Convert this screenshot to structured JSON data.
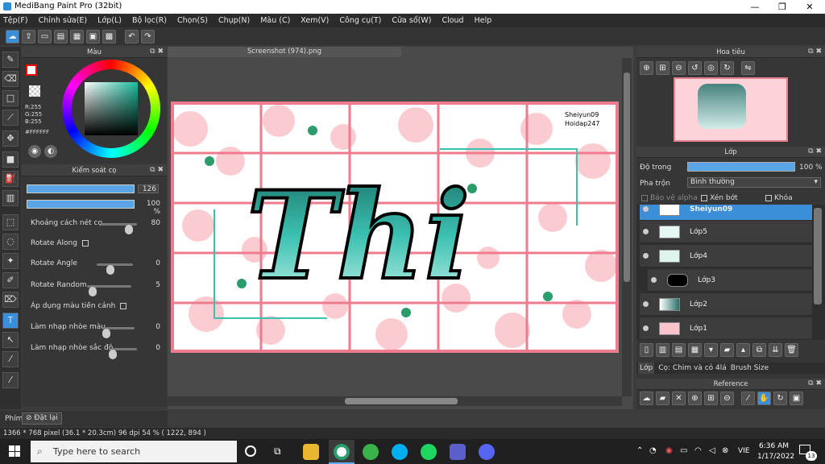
{
  "app": {
    "title": "MediBang Paint Pro (32bit)"
  },
  "window": {
    "minimize": "—",
    "maximize": "❐",
    "close": "✕"
  },
  "menu": [
    "Tệp(F)",
    "Chỉnh sửa(E)",
    "Lớp(L)",
    "Bộ lọc(R)",
    "Chọn(S)",
    "Chụp(N)",
    "Màu (C)",
    "Xem(V)",
    "Công cụ(T)",
    "Cửa sổ(W)",
    "Cloud",
    "Help"
  ],
  "color_panel": {
    "title": "Màu",
    "r": "R:255",
    "g": "G:255",
    "b": "B:255",
    "hex": "#FFFFFF",
    "accent": "#ff0000"
  },
  "brush_panel": {
    "title": "Kiểm soát cọ",
    "size": "126",
    "opacity": "100 %",
    "rows": [
      {
        "label": "Khoảng cách nét cọ",
        "value": "80",
        "level": 0.85
      },
      {
        "label": "Rotate Along",
        "checkbox": true
      },
      {
        "label": "Rotate Angle",
        "value": "0",
        "level": 0.35
      },
      {
        "label": "Rotate Random",
        "value": "5",
        "level": 0.05
      },
      {
        "label": "Áp dụng màu tiền cảnh",
        "checkbox": true
      },
      {
        "label": "Làm nhạp nhòe màu",
        "value": "0",
        "level": 0.0
      },
      {
        "label": "Làm nhạp nhòe sắc độ",
        "value": "0",
        "level": 0.0
      }
    ]
  },
  "document": {
    "tab": "Screenshot (974).png",
    "watermark_line1": "Sheiyun09",
    "watermark_line2": "Hoidap247",
    "art_text": "Thi",
    "art_accent": "#3bc1b1"
  },
  "navigator": {
    "title": "Hoa tiêu"
  },
  "layers": {
    "title": "Lớp",
    "opacity_label": "Độ trong",
    "opacity_value": "100 %",
    "blend_label": "Pha trộn",
    "blend_value": "Bình thường",
    "protect_alpha": "Bảo vệ alpha",
    "clipping": "Xén bớt",
    "lock": "Khóa",
    "items": [
      {
        "name": "Sheiyun09",
        "selected": true
      },
      {
        "name": "Lớp5"
      },
      {
        "name": "Lớp4"
      },
      {
        "name": "Lớp3"
      },
      {
        "name": "Lớp2"
      },
      {
        "name": "Lớp1"
      }
    ],
    "tab1": "Lớp",
    "tab2": "Cọ: Chim và cỏ 4lá",
    "tab3": "Brush Size"
  },
  "reference": {
    "title": "Reference"
  },
  "bottom": {
    "tab": "Phím",
    "reset": "Đặt lại"
  },
  "status": {
    "text": "1366 * 768 pixel   (36.1 * 20.3cm)   96 dpi   54 %   ( 1222, 894 )"
  },
  "taskbar": {
    "search": "Type here to search",
    "time": "6:36 AM",
    "date": "1/17/2022",
    "lang": "VIE",
    "notif": "13"
  }
}
